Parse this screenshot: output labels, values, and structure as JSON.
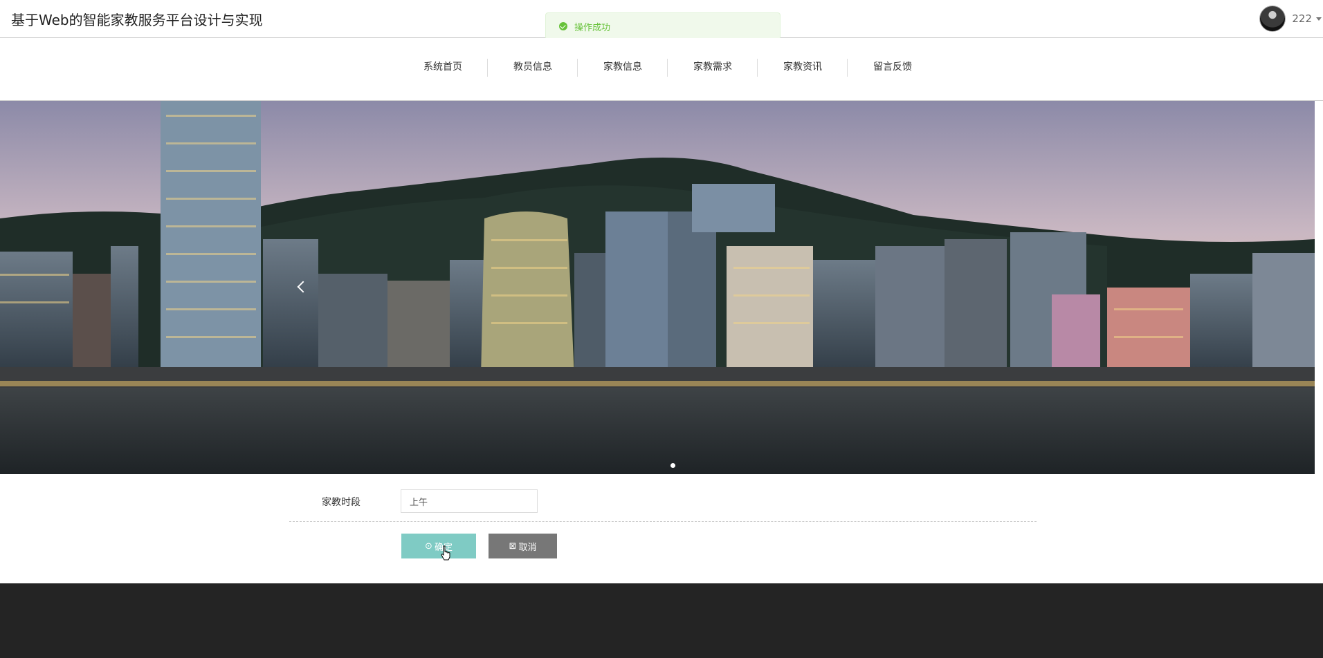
{
  "header": {
    "title": "基于Web的智能家教服务平台设计与实现",
    "username": "222"
  },
  "toast": {
    "message": "操作成功",
    "color": "#67c23a"
  },
  "nav": {
    "items": [
      "系统首页",
      "教员信息",
      "家教信息",
      "家教需求",
      "家教资讯",
      "留言反馈"
    ]
  },
  "banner": {
    "slide_count": 1,
    "active_slide": 1
  },
  "form": {
    "label": "家教时段",
    "value": "上午"
  },
  "buttons": {
    "confirm": "确定",
    "cancel": "取消",
    "confirm_icon": "check-circle-icon",
    "cancel_icon": "close-square-icon"
  },
  "colors": {
    "confirm_button": "#7fcbc4",
    "cancel_button": "#777777",
    "footer": "#242424"
  }
}
